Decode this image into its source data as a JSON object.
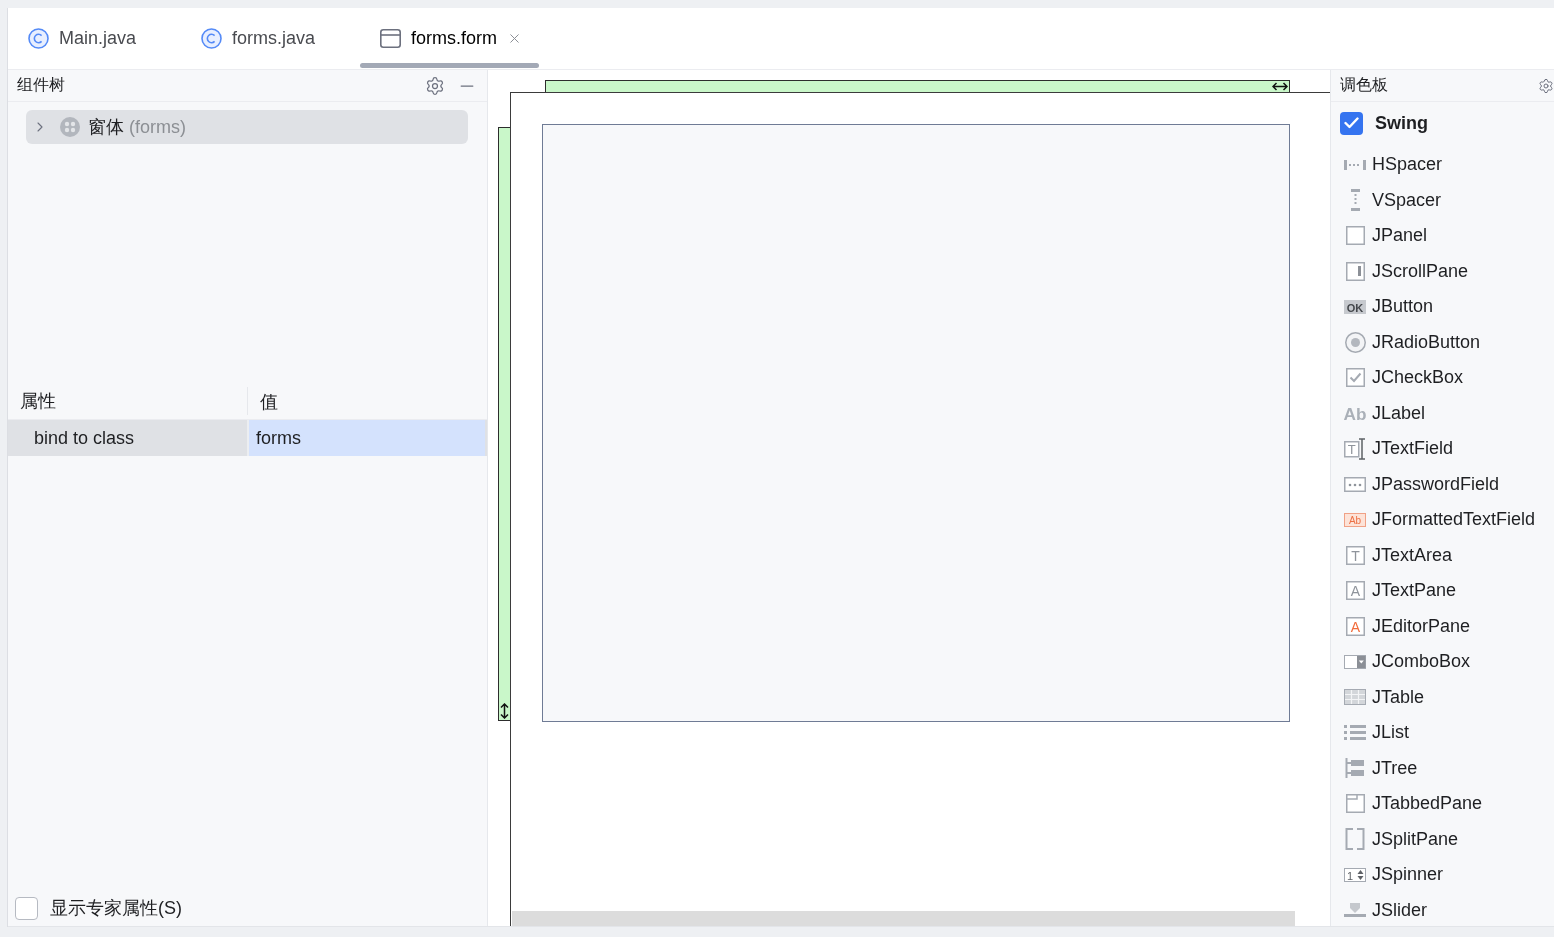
{
  "tabs": [
    {
      "label": "Main.java",
      "kind": "class",
      "selected": false
    },
    {
      "label": "forms.java",
      "kind": "class",
      "selected": false
    },
    {
      "label": "forms.form",
      "kind": "form",
      "selected": true
    }
  ],
  "component_tree": {
    "title": "组件树",
    "items": [
      {
        "label": "窗体",
        "detail": "(forms)",
        "expanded": false,
        "selected": true
      }
    ]
  },
  "properties": {
    "columns": [
      "属性",
      "值"
    ],
    "rows": [
      {
        "name": "bind to class",
        "value": "forms",
        "selected": true
      }
    ]
  },
  "expert_toggle": {
    "label": "显示专家属性(S)",
    "checked": false
  },
  "palette": {
    "title": "调色板",
    "groups": [
      {
        "name": "Swing",
        "checked": true,
        "items": [
          {
            "label": "HSpacer"
          },
          {
            "label": "VSpacer"
          },
          {
            "label": "JPanel"
          },
          {
            "label": "JScrollPane"
          },
          {
            "label": "JButton",
            "glyph": "OK"
          },
          {
            "label": "JRadioButton"
          },
          {
            "label": "JCheckBox"
          },
          {
            "label": "JLabel",
            "glyph": "Ab"
          },
          {
            "label": "JTextField",
            "glyph": "T"
          },
          {
            "label": "JPasswordField"
          },
          {
            "label": "JFormattedTextField",
            "glyph": "Ab"
          },
          {
            "label": "JTextArea",
            "glyph": "T"
          },
          {
            "label": "JTextPane",
            "glyph": "A"
          },
          {
            "label": "JEditorPane",
            "glyph": "A"
          },
          {
            "label": "JComboBox"
          },
          {
            "label": "JTable"
          },
          {
            "label": "JList"
          },
          {
            "label": "JTree"
          },
          {
            "label": "JTabbedPane"
          },
          {
            "label": "JSplitPane"
          },
          {
            "label": "JSpinner",
            "glyph": "1"
          },
          {
            "label": "JSlider"
          }
        ]
      }
    ]
  }
}
